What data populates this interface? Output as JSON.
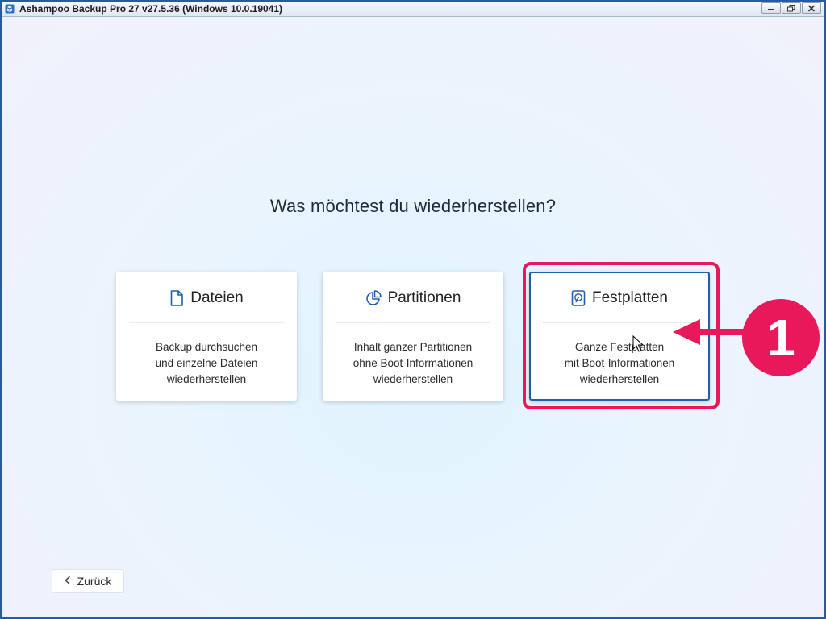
{
  "window": {
    "title": "Ashampoo Backup Pro 27 v27.5.36 (Windows 10.0.19041)",
    "icon": "app-stack-icon",
    "controls": [
      "minimize",
      "restore",
      "close"
    ]
  },
  "main": {
    "heading": "Was möchtest du wiederherstellen?",
    "cards": [
      {
        "title": "Dateien",
        "icon": "file-icon",
        "description": [
          "Backup durchsuchen",
          "und einzelne Dateien",
          "wiederherstellen"
        ],
        "selected": false
      },
      {
        "title": "Partitionen",
        "icon": "pie-chart-icon",
        "description": [
          "Inhalt ganzer Partitionen",
          "ohne Boot-Informationen",
          "wiederherstellen"
        ],
        "selected": false
      },
      {
        "title": "Festplatten",
        "icon": "hard-disk-icon",
        "description": [
          "Ganze Festplatten",
          "mit Boot-Informationen",
          "wiederherstellen"
        ],
        "selected": true
      }
    ],
    "back_label": "Zurück"
  },
  "annotation": {
    "step_number": "1",
    "color": "#e8185a"
  },
  "colors": {
    "accent": "#1f5fa8",
    "annotation": "#e8185a"
  }
}
